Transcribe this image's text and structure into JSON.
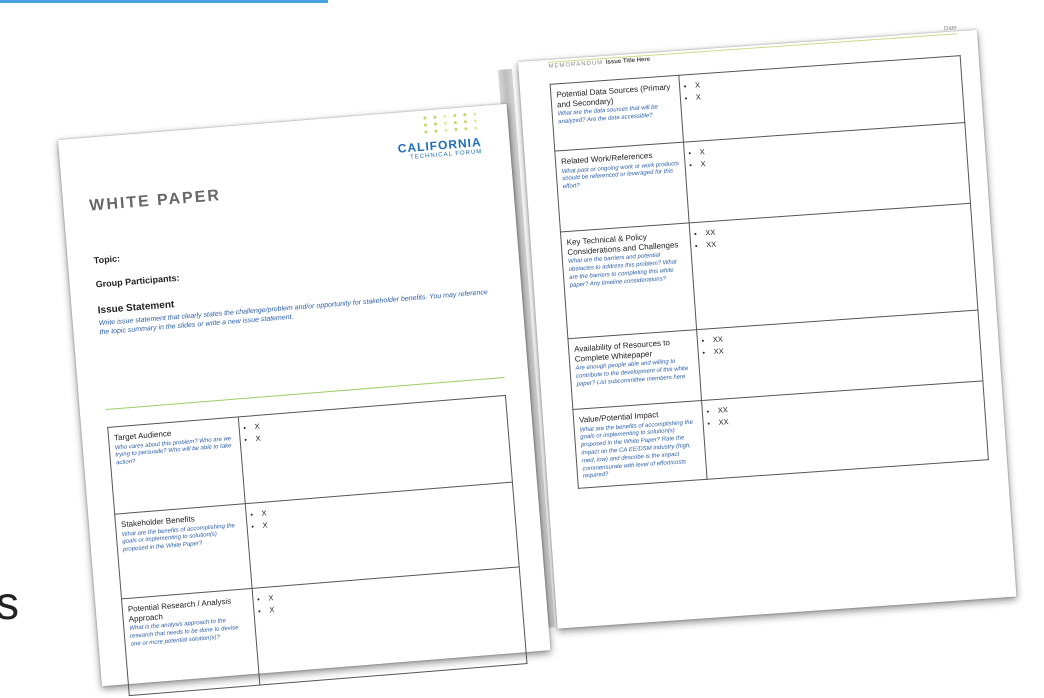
{
  "left_page": {
    "logo": {
      "name": "CALIFORNIA",
      "subtitle": "TECHNICAL FORUM"
    },
    "title": "WHITE PAPER",
    "topic_label": "Topic:",
    "participants_label": "Group Participants:",
    "issue_heading": "Issue Statement",
    "issue_text": "Write issue statement that clearly states the challenge/problem and/or opportunity for stakeholder benefits. You may reference the topic summary in the slides or write a new issue statement.",
    "rows": [
      {
        "title": "Target Audience",
        "hint": "Who cares about this problem? Who are we trying to persuade? Who will be able to take action?",
        "bullets": [
          "X",
          "X"
        ]
      },
      {
        "title": "Stakeholder Benefits",
        "hint": "What are the benefits of accomplishing the goals or implementing to solution(s) proposed in the White Paper?",
        "bullets": [
          "X",
          "X"
        ]
      },
      {
        "title": "Potential Research / Analysis Approach",
        "hint": "What is the analysis approach to the research that needs to be done to devise one or more potential solution(s)?",
        "bullets": [
          "X",
          "X"
        ]
      }
    ]
  },
  "right_page": {
    "memo_label": "MEMORANDUM",
    "memo_title": "Issue Title Here",
    "date_label": "Date",
    "rows": [
      {
        "title": "Potential Data Sources (Primary and Secondary)",
        "hint": "What are the data sources that will be analyzed? Are the data accessible?",
        "bullets": [
          "X",
          "X"
        ]
      },
      {
        "title": "Related Work/References",
        "hint": "What past or ongoing work or work products should be referenced or leveraged for this effort?",
        "bullets": [
          "X",
          "X"
        ]
      },
      {
        "title": "Key Technical & Policy Considerations and Challenges",
        "hint": "What are the barriers and potential obstacles to address this problem? What are the barriers to completing this white paper? Any timeline considerations?",
        "bullets": [
          "XX",
          "XX"
        ]
      },
      {
        "title": "Availability of Resources to Complete Whitepaper",
        "hint": "Are enough people able and willing to contribute to the development of this white paper? List subcommittee members here",
        "bullets": [
          "XX",
          "XX"
        ]
      },
      {
        "title": "Value/Potential Impact",
        "hint": "What are the benefits of accomplishing the goals or implementing to solution(s) proposed in the White Paper? Rate the impact on the CA EE/DSM industry (high, med, low) and describe is the impact commensurate with level of effort/costs required?",
        "bullets": [
          "XX",
          "XX"
        ]
      }
    ]
  },
  "edge_glyph": "s",
  "colors": {
    "accent_blue": "#2a5ea8",
    "logo_blue": "#1e6db6",
    "rule_green": "#9ccf66",
    "link_blue": "#4aa3e0"
  }
}
